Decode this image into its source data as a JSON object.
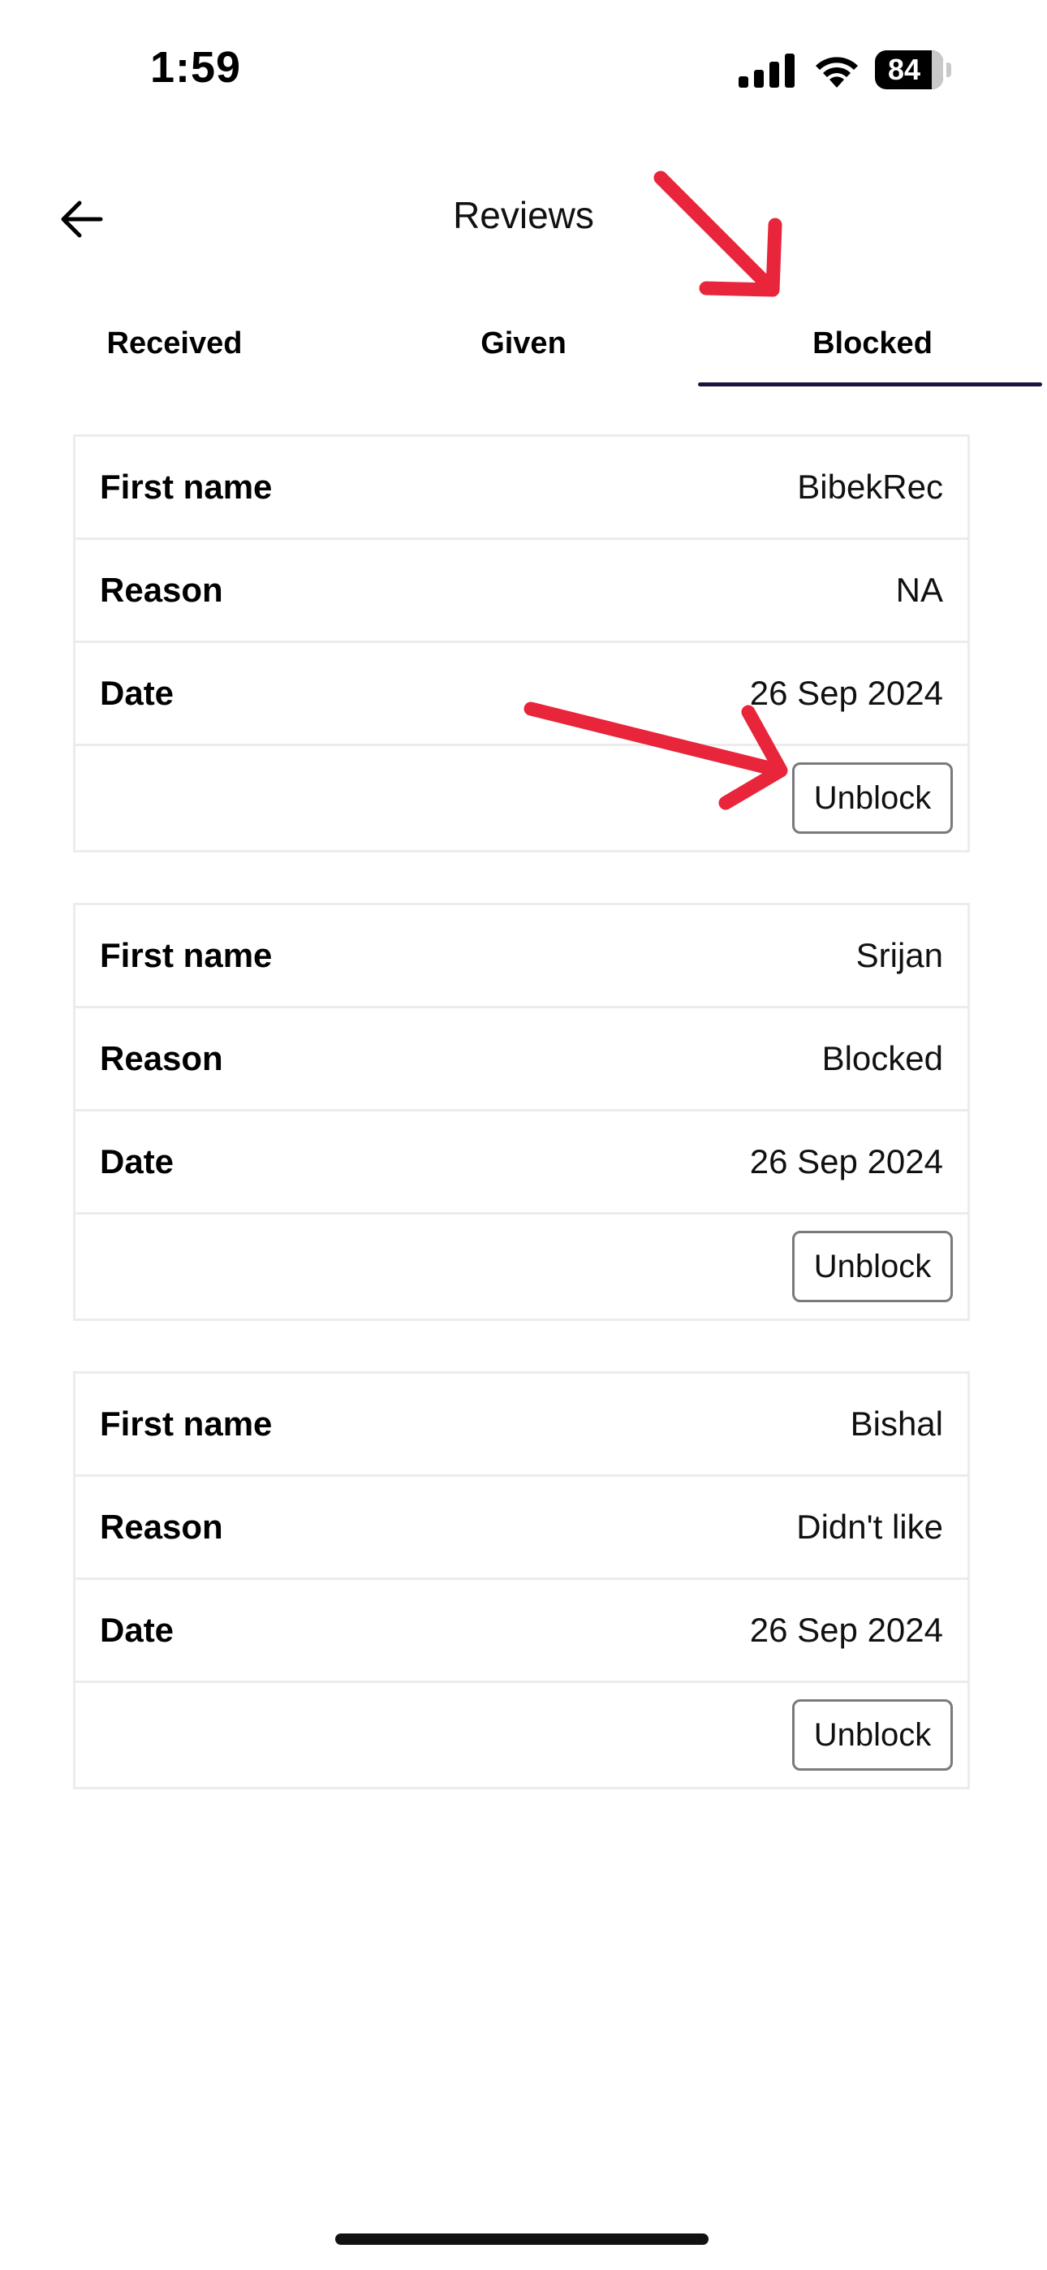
{
  "status_bar": {
    "time": "1:59",
    "battery_percent": "84",
    "icons": [
      "cellular-signal-icon",
      "wifi-icon",
      "battery-icon"
    ]
  },
  "header": {
    "title": "Reviews",
    "back_icon": "arrow-left-icon"
  },
  "tabs": [
    {
      "label": "Received",
      "selected": false
    },
    {
      "label": "Given",
      "selected": false
    },
    {
      "label": "Blocked",
      "selected": true
    }
  ],
  "fields": {
    "first_name": "First name",
    "reason": "Reason",
    "date": "Date"
  },
  "blocked_users": [
    {
      "first_name": "BibekRec",
      "reason": "NA",
      "date": "26 Sep 2024",
      "action": "Unblock"
    },
    {
      "first_name": "Srijan",
      "reason": "Blocked",
      "date": "26 Sep 2024",
      "action": "Unblock"
    },
    {
      "first_name": "Bishal",
      "reason": "Didn't like",
      "date": "26 Sep 2024",
      "action": "Unblock"
    }
  ],
  "annotation_color": "#e8253a",
  "accent_color": "#1a1440"
}
